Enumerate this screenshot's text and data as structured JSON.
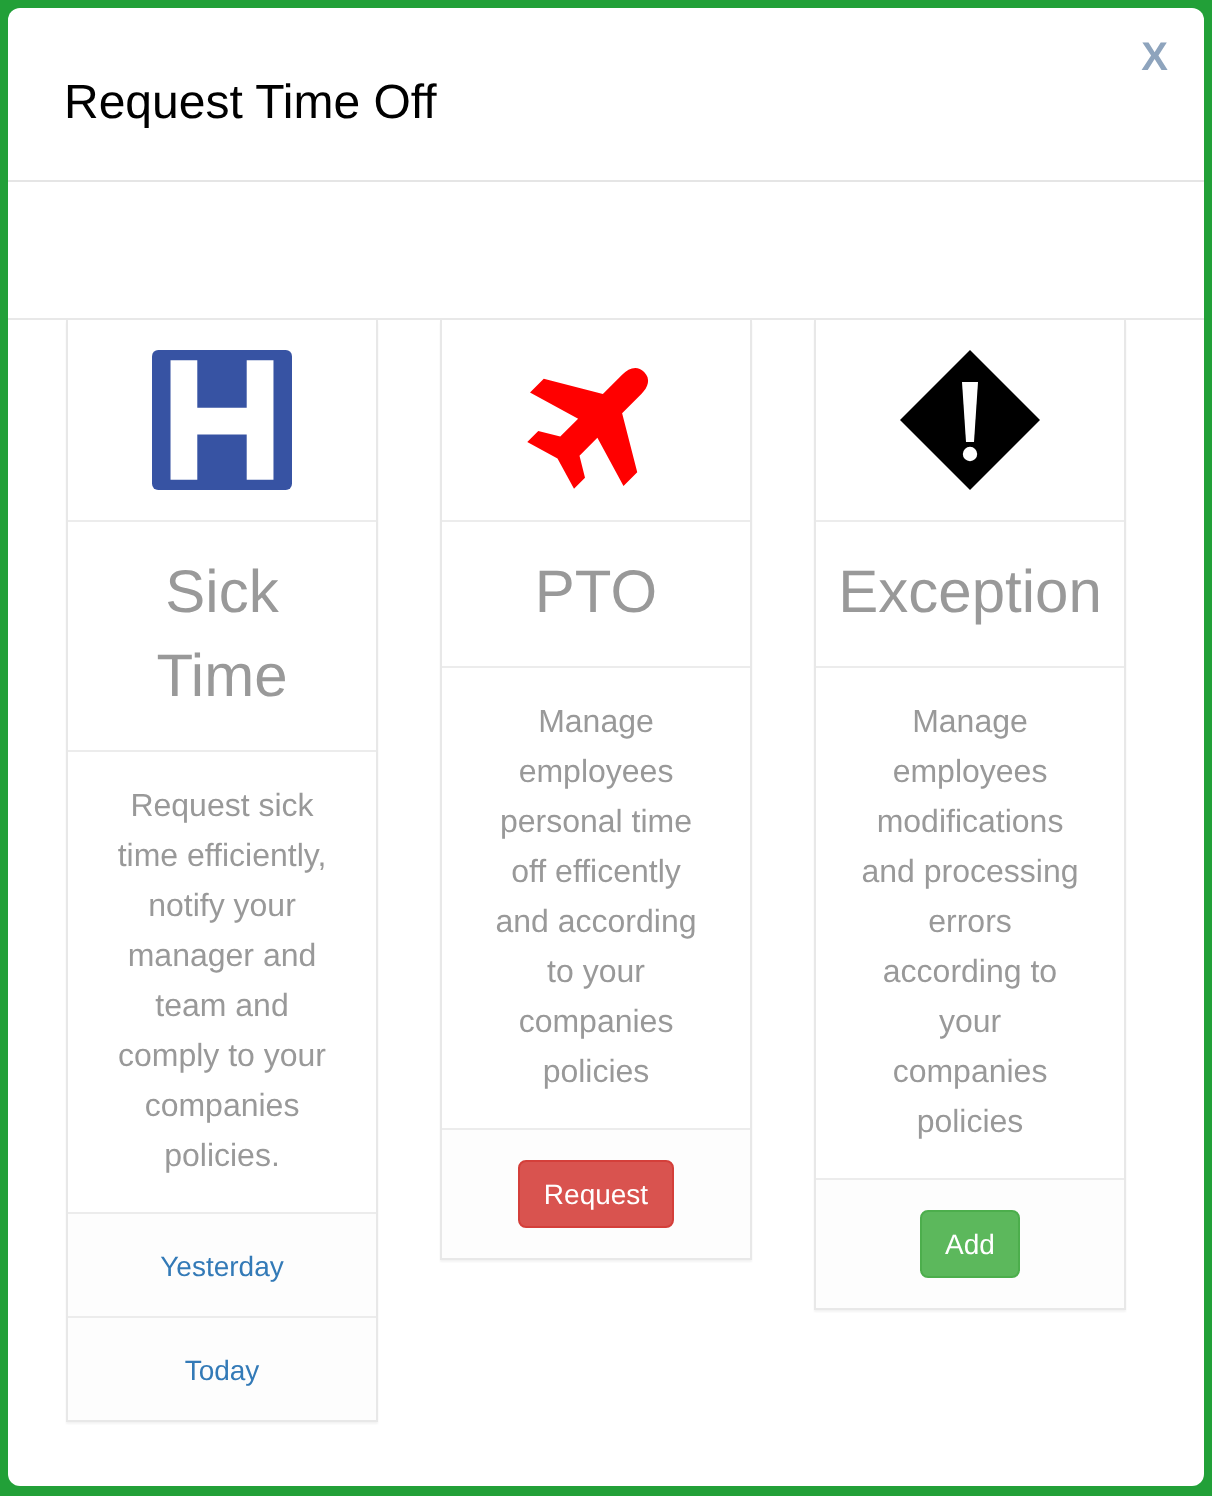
{
  "dialog": {
    "title": "Request Time Off",
    "close": "X"
  },
  "cards": [
    {
      "kind": "medical",
      "title": "Sick Time",
      "description": "Request sick time efficiently, notify your manager and team and comply to your companies policies.",
      "actions": [
        {
          "kind": "link",
          "label": "Yesterday"
        },
        {
          "kind": "link",
          "label": "Today"
        }
      ]
    },
    {
      "kind": "travel",
      "title": "PTO",
      "description": "Manage employees personal time off efficently and according to your companies policies",
      "actions": [
        {
          "kind": "danger",
          "label": "Request"
        }
      ]
    },
    {
      "kind": "alert",
      "title": "Exception",
      "description": "Manage employees modifications and processing errors according to your companies policies",
      "actions": [
        {
          "kind": "success",
          "label": "Add"
        }
      ]
    }
  ]
}
